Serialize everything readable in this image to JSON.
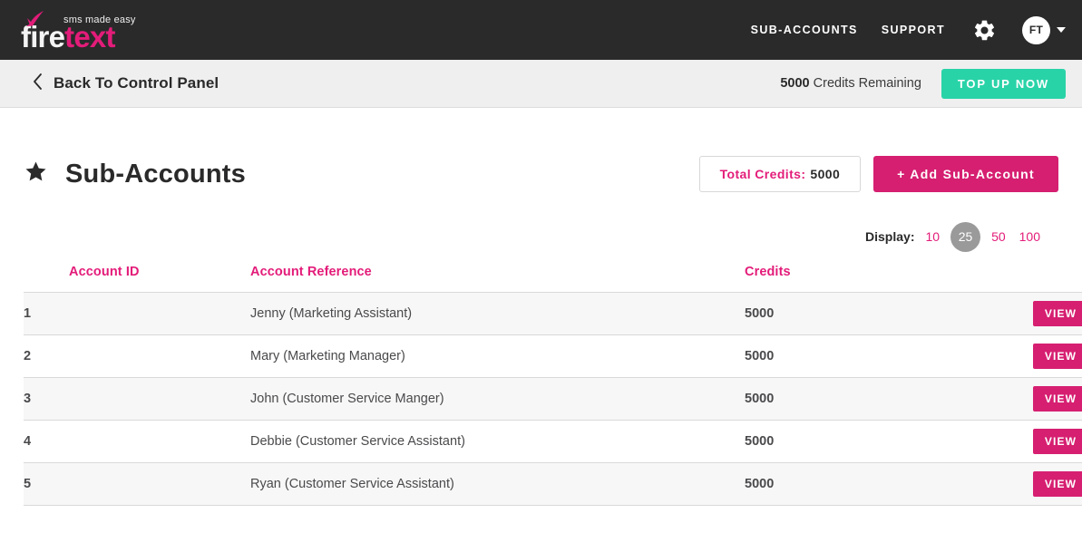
{
  "header": {
    "logo": {
      "tagline": "sms made easy",
      "word_first": "fire",
      "word_second": "text",
      "flame_icon": "flame-icon"
    },
    "nav": [
      {
        "label": "SUB-ACCOUNTS",
        "name": "nav-sub-accounts"
      },
      {
        "label": "SUPPORT",
        "name": "nav-support"
      }
    ],
    "gear_icon": "gear-icon",
    "avatar_initials": "FT",
    "caret_icon": "chevron-down-icon"
  },
  "subbar": {
    "back_label": "Back To Control Panel",
    "back_icon": "chevron-left-icon",
    "credits_number": "5000",
    "credits_text": "Credits Remaining",
    "topup_label": "TOP UP NOW"
  },
  "page": {
    "star_icon": "star-icon",
    "title": "Sub-Accounts",
    "total_credits_label": "Total Credits:",
    "total_credits_value": "5000",
    "add_button_label": "+ Add Sub-Account"
  },
  "display": {
    "label": "Display:",
    "options": [
      "10",
      "25",
      "50",
      "100"
    ],
    "selected": "25"
  },
  "table": {
    "columns": [
      "Account ID",
      "Account Reference",
      "Credits",
      ""
    ],
    "view_label": "VIEW",
    "view_icon": "chevron-right-icon",
    "rows": [
      {
        "id": "1",
        "reference": "Jenny (Marketing Assistant)",
        "credits": "5000"
      },
      {
        "id": "2",
        "reference": "Mary (Marketing Manager)",
        "credits": "5000"
      },
      {
        "id": "3",
        "reference": "John (Customer Service Manger)",
        "credits": "5000"
      },
      {
        "id": "4",
        "reference": "Debbie (Customer Service Assistant)",
        "credits": "5000"
      },
      {
        "id": "5",
        "reference": "Ryan (Customer Service Assistant)",
        "credits": "5000"
      }
    ]
  },
  "colors": {
    "brand_pink": "#e31c79",
    "button_pink": "#d61f71",
    "teal": "#29d3a8",
    "header_dark": "#2a2a2b",
    "subbar_grey": "#efefef",
    "row_alt": "#f7f7f7"
  }
}
